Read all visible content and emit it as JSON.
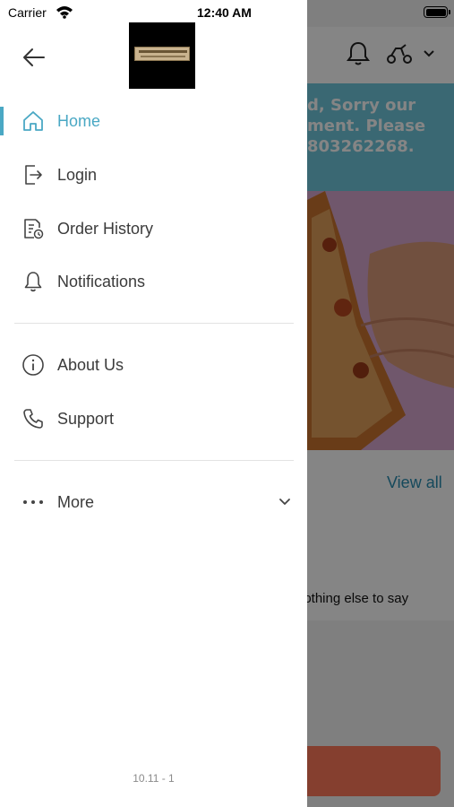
{
  "status_bar": {
    "carrier": "Carrier",
    "time": "12:40 AM"
  },
  "drawer": {
    "menu": [
      {
        "label": "Home",
        "icon": "home-icon",
        "active": true
      },
      {
        "label": "Login",
        "icon": "login-icon"
      },
      {
        "label": "Order History",
        "icon": "order-history-icon"
      },
      {
        "label": "Notifications",
        "icon": "bell-icon"
      }
    ],
    "info_menu": [
      {
        "label": "About Us",
        "icon": "info-icon"
      },
      {
        "label": "Support",
        "icon": "phone-icon"
      }
    ],
    "more": {
      "label": "More",
      "icon": "more-dots-icon"
    },
    "version": "10.11 - 1"
  },
  "background": {
    "banner_lines": [
      "d, Sorry our",
      "ment. Please",
      "803262268."
    ],
    "view_all": "View all",
    "subtext": "lothing else to say"
  },
  "colors": {
    "accent": "#4aa8c4",
    "banner": "#6fc7dc",
    "cta": "#ff7a5a"
  }
}
